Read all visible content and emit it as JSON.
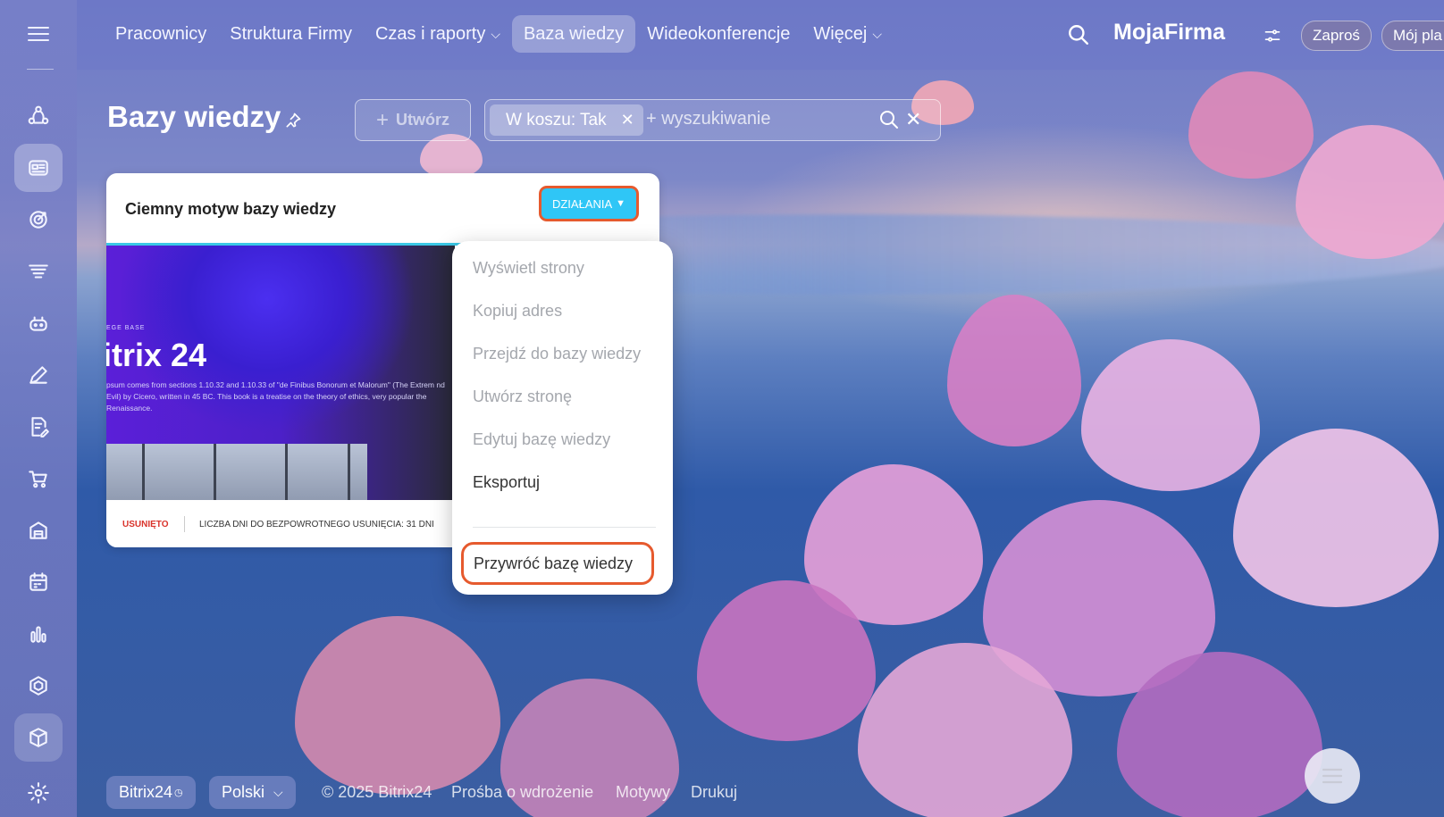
{
  "nav": {
    "items": [
      {
        "label": "Pracownicy",
        "dropdown": false,
        "active": false
      },
      {
        "label": "Struktura Firmy",
        "dropdown": false,
        "active": false
      },
      {
        "label": "Czas i raporty",
        "dropdown": true,
        "active": false
      },
      {
        "label": "Baza wiedzy",
        "dropdown": false,
        "active": true
      },
      {
        "label": "Wideokonferencje",
        "dropdown": false,
        "active": false
      },
      {
        "label": "Więcej",
        "dropdown": true,
        "active": false
      }
    ],
    "brand": "MojaFirma",
    "invite_label": "Zaproś",
    "plan_label": "Mój pla"
  },
  "sidebar": {
    "icons": [
      "network-icon",
      "knowledge-base-icon",
      "target-icon",
      "funnel-icon",
      "robot-icon",
      "pen-icon",
      "document-edit-icon",
      "cart-icon",
      "store-icon",
      "calendar-icon",
      "analytics-icon",
      "hexagon-icon",
      "box-icon",
      "settings-icon"
    ],
    "active_index": 1
  },
  "page": {
    "title": "Bazy wiedzy",
    "create_label": "Utwórz",
    "filter_chip": "W koszu: Tak",
    "search_placeholder": "+ wyszukiwanie"
  },
  "card": {
    "title": "Ciemny motyw bazy wiedzy",
    "actions_label": "DZIAŁANIA",
    "preview": {
      "eyebrow": "EGE BASE",
      "title": "itrix 24",
      "text": "psum comes from sections 1.10.32 and 1.10.33 of \"de Finibus Bonorum et Malorum\" (The Extrem nd Evil) by Cicero, written in 45 BC. This book is a treatise on the theory of ethics, very popular the Renaissance."
    },
    "status": "USUNIĘTO",
    "days_left": "LICZBA DNI DO BEZPOWROTNEGO USUNIĘCIA: 31 DNI"
  },
  "menu": {
    "items": [
      {
        "label": "Wyświetl strony",
        "enabled": false
      },
      {
        "label": "Kopiuj adres",
        "enabled": false
      },
      {
        "label": "Przejdź do bazy wiedzy",
        "enabled": false
      },
      {
        "label": "Utwórz stronę",
        "enabled": false
      },
      {
        "label": "Edytuj bazę wiedzy",
        "enabled": false
      },
      {
        "label": "Eksportuj",
        "enabled": true
      }
    ],
    "restore_label": "Przywróć bazę wiedzy"
  },
  "footer": {
    "logo": "Bitrix24",
    "language": "Polski",
    "copyright": "© 2025 Bitrix24",
    "links": [
      "Prośba o wdrożenie",
      "Motywy",
      "Drukuj"
    ]
  },
  "colors": {
    "accent": "#2fc6f6",
    "highlight": "#e65a2e",
    "removed": "#d9332b"
  }
}
